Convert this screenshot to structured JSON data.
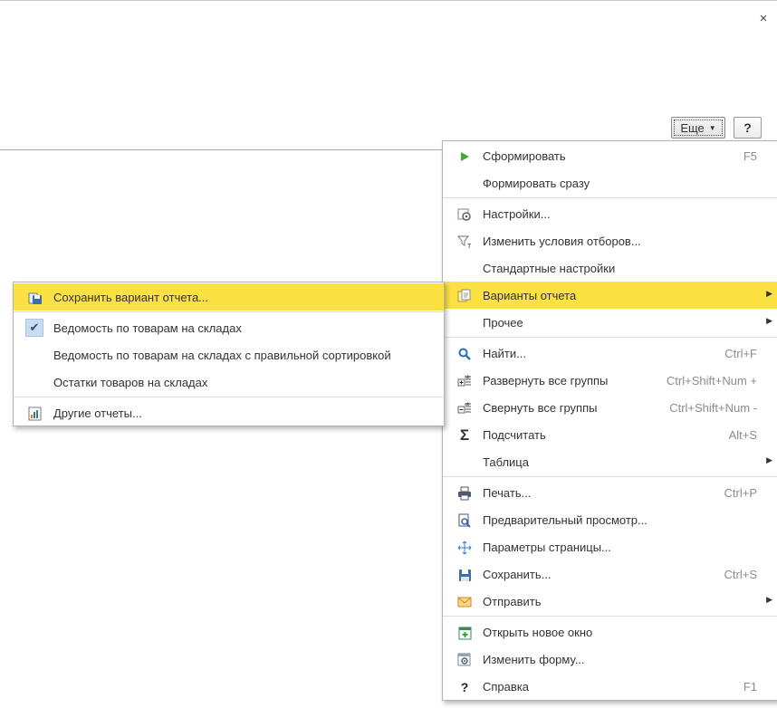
{
  "window": {
    "close_glyph": "×"
  },
  "toolbar": {
    "more_label": "Еще",
    "help_label": "?"
  },
  "main_menu": {
    "items": [
      {
        "label": "Сформировать",
        "shortcut": "F5",
        "icon": "play-icon"
      },
      {
        "label": "Формировать сразу",
        "shortcut": "",
        "icon": ""
      },
      {
        "label": "Настройки...",
        "shortcut": "",
        "icon": "settings-icon"
      },
      {
        "label": "Изменить условия отборов...",
        "shortcut": "",
        "icon": "filter-icon"
      },
      {
        "label": "Стандартные настройки",
        "shortcut": "",
        "icon": ""
      },
      {
        "label": "Варианты отчета",
        "shortcut": "",
        "icon": "report-variants-icon",
        "submenu": true,
        "highlighted": true
      },
      {
        "label": "Прочее",
        "shortcut": "",
        "icon": "",
        "submenu": true
      },
      {
        "label": "Найти...",
        "shortcut": "Ctrl+F",
        "icon": "search-icon"
      },
      {
        "label": "Развернуть все группы",
        "shortcut": "Ctrl+Shift+Num +",
        "icon": "expand-groups-icon"
      },
      {
        "label": "Свернуть все группы",
        "shortcut": "Ctrl+Shift+Num -",
        "icon": "collapse-groups-icon"
      },
      {
        "label": "Подсчитать",
        "shortcut": "Alt+S",
        "icon": "sigma-icon"
      },
      {
        "label": "Таблица",
        "shortcut": "",
        "icon": "",
        "submenu": true
      },
      {
        "label": "Печать...",
        "shortcut": "Ctrl+P",
        "icon": "printer-icon"
      },
      {
        "label": "Предварительный просмотр...",
        "shortcut": "",
        "icon": "print-preview-icon"
      },
      {
        "label": "Параметры страницы...",
        "shortcut": "",
        "icon": "page-setup-icon"
      },
      {
        "label": "Сохранить...",
        "shortcut": "Ctrl+S",
        "icon": "save-icon"
      },
      {
        "label": "Отправить",
        "shortcut": "",
        "icon": "envelope-icon",
        "submenu": true
      },
      {
        "label": "Открыть новое окно",
        "shortcut": "",
        "icon": "new-window-icon"
      },
      {
        "label": "Изменить форму...",
        "shortcut": "",
        "icon": "edit-form-icon"
      },
      {
        "label": "Справка",
        "shortcut": "F1",
        "icon": "help-icon"
      }
    ]
  },
  "sub_menu": {
    "items": [
      {
        "label": "Сохранить вариант отчета...",
        "icon": "save-variant-icon",
        "highlighted": true
      },
      {
        "label": "Ведомость по товарам на складах",
        "icon": "check-icon",
        "checked": true
      },
      {
        "label": "Ведомость по товарам на складах с правильной сортировкой",
        "icon": ""
      },
      {
        "label": "Остатки товаров на складах",
        "icon": ""
      },
      {
        "label": "Другие отчеты...",
        "icon": "other-reports-icon"
      }
    ]
  },
  "colors": {
    "highlight": "#fbe141",
    "check_bg": "#c9dcf0",
    "shortcut_text": "#8c8c8c",
    "play_green": "#3fae2a"
  }
}
